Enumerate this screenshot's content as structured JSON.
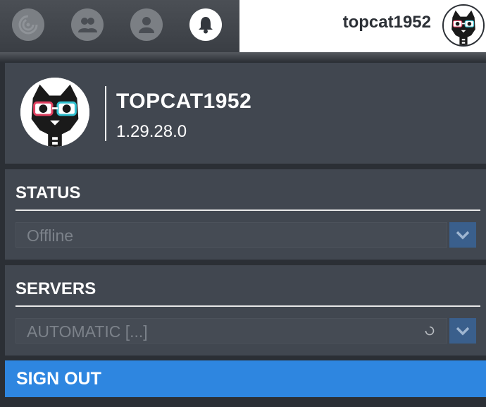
{
  "topbar": {
    "nav_icons": [
      {
        "name": "news-icon",
        "active": false
      },
      {
        "name": "friends-icon",
        "active": false
      },
      {
        "name": "profile-icon",
        "active": false
      },
      {
        "name": "notifications-bell-icon",
        "active": true
      }
    ],
    "username": "topcat1952"
  },
  "profile": {
    "name": "TOPCAT1952",
    "version": "1.29.28.0"
  },
  "status": {
    "title": "STATUS",
    "selected": "Offline"
  },
  "servers": {
    "title": "SERVERS",
    "selected": "AUTOMATIC [...]"
  },
  "signout": {
    "label": "SIGN OUT"
  },
  "colors": {
    "accent": "#2e86e0",
    "panel": "#414750",
    "background": "#2b2f35",
    "dropdown_arrow": "#3a5f8c"
  }
}
